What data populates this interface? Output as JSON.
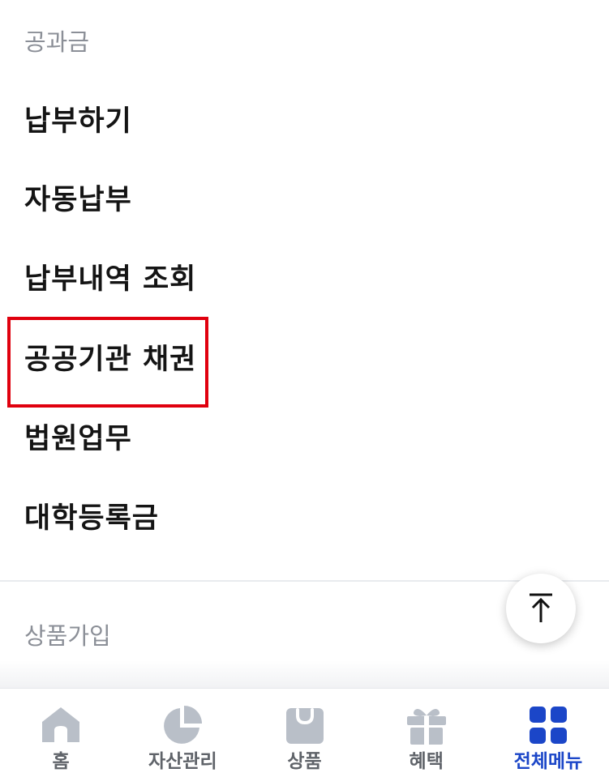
{
  "sections": {
    "utility_label": "공과금",
    "product_label": "상품가입"
  },
  "menu": [
    {
      "label": "납부하기"
    },
    {
      "label": "자동납부"
    },
    {
      "label": "납부내역 조회"
    },
    {
      "label": "공공기관 채권"
    },
    {
      "label": "법원업무"
    },
    {
      "label": "대학등록금"
    }
  ],
  "highlighted_item": "공공기관 채권",
  "bottom_nav": [
    {
      "label": "홈",
      "icon": "home-icon"
    },
    {
      "label": "자산관리",
      "icon": "pie-chart-icon"
    },
    {
      "label": "상품",
      "icon": "shopping-bag-icon"
    },
    {
      "label": "혜택",
      "icon": "gift-icon"
    },
    {
      "label": "전체메뉴",
      "icon": "grid-icon",
      "active": true
    }
  ],
  "colors": {
    "accent": "#1b46c8",
    "highlight_border": "#e0000e",
    "icon_inactive": "#b9bfc8"
  }
}
